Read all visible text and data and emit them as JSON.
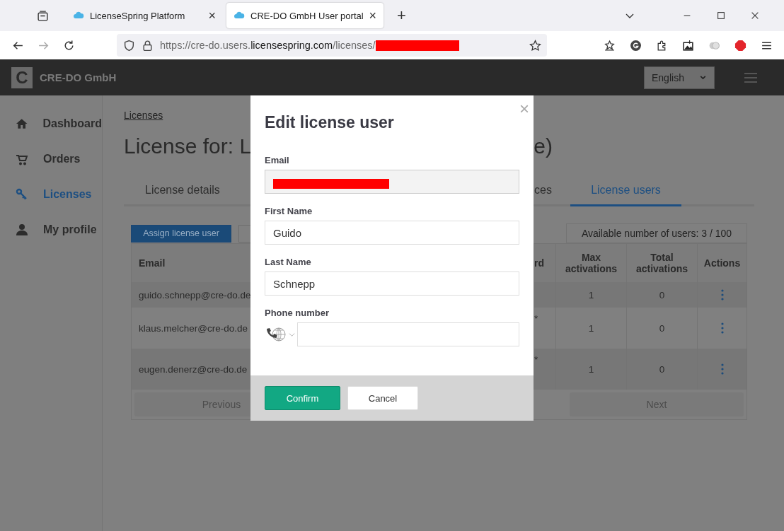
{
  "browser": {
    "tabs": [
      {
        "title": "LicenseSpring Platform",
        "selected": false,
        "close": "×"
      },
      {
        "title": "CRE-DO GmbH User portal",
        "selected": true,
        "close": "×"
      }
    ],
    "new_tab": "+",
    "url": {
      "prefix": "https://cre-do.users.",
      "domain": "licensespring.com",
      "path": "/licenses/",
      "redacted": true
    }
  },
  "header": {
    "logo_letter": "C",
    "company": "CRE-DO GmbH",
    "language": "English"
  },
  "sidebar": {
    "items": [
      {
        "label": "Dashboard",
        "selected": false
      },
      {
        "label": "Orders",
        "selected": false
      },
      {
        "label": "Licenses",
        "selected": true
      },
      {
        "label": "My profile",
        "selected": false
      }
    ]
  },
  "breadcrumb": "Licenses",
  "page_title": {
    "start": "License for: L",
    "end": "e)"
  },
  "tabs": [
    {
      "label": "License details",
      "selected": false
    },
    {
      "label": "ces",
      "selected": false
    },
    {
      "label": "License users",
      "selected": true
    }
  ],
  "assign_button": "Assign license user",
  "available_users": "Available number of users: 3 / 100",
  "table": {
    "columns": [
      "Email",
      "rd",
      "Max activations",
      "Total activations",
      "Actions"
    ],
    "rows": [
      {
        "email": "guido.schnepp@cre-do.de",
        "max": "1",
        "total": "0"
      },
      {
        "email": "klaus.melcher@cre-do.de",
        "column_2": "*",
        "max": "1",
        "total": "0"
      },
      {
        "email": "eugen.denerz@cre-do.de",
        "column_2": "*",
        "max": "1",
        "total": "0"
      }
    ]
  },
  "pagination": {
    "previous": "Previous",
    "next": "Next",
    "disabled": true
  },
  "modal": {
    "title": "Edit license user",
    "close": "×",
    "fields": [
      {
        "label": "Email",
        "kind": "readonly",
        "redacted": true
      },
      {
        "label": "First Name",
        "kind": "text",
        "value": "Guido"
      },
      {
        "label": "Last Name",
        "kind": "text",
        "value": "Schnepp"
      },
      {
        "label": "Phone number",
        "kind": "phone"
      }
    ],
    "buttons": [
      {
        "label": "Confirm",
        "kind": "primary"
      },
      {
        "label": "Cancel",
        "kind": "secondary"
      }
    ]
  }
}
